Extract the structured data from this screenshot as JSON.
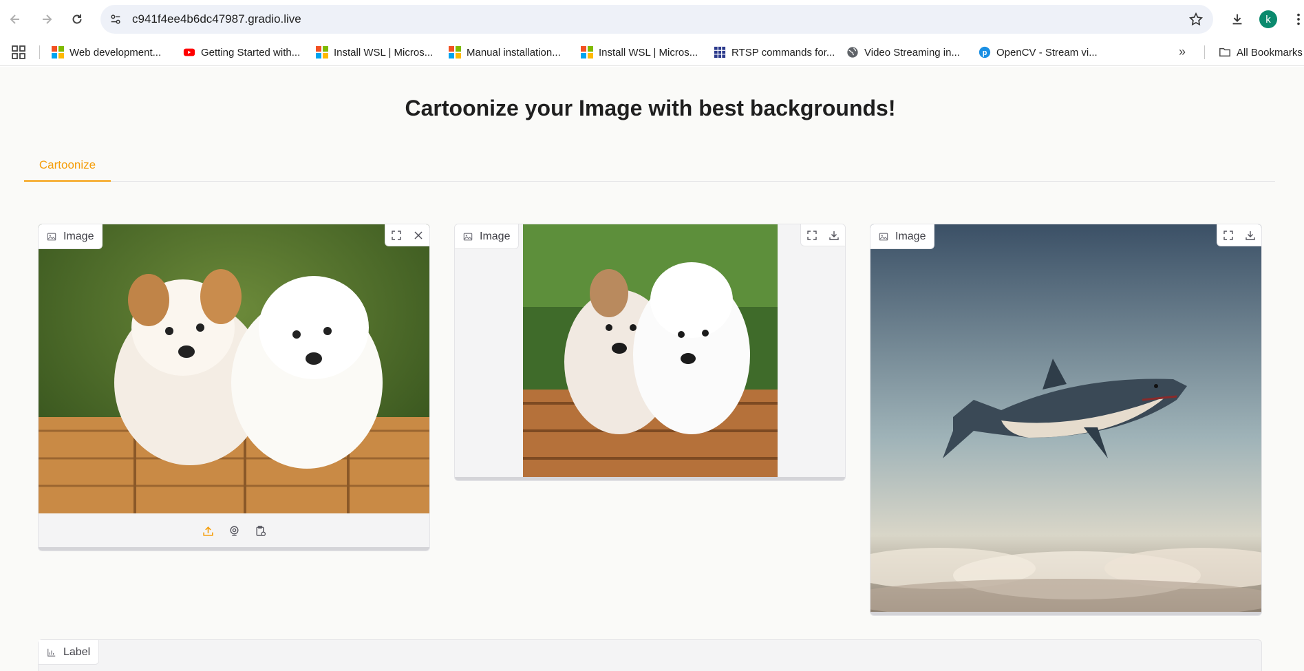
{
  "browser": {
    "url": "c941f4ee4b6dc47987.gradio.live",
    "avatar_letter": "k",
    "bookmarks": [
      {
        "label": "Web development...",
        "icon": "microsoft-icon"
      },
      {
        "label": "Getting Started with...",
        "icon": "youtube-icon"
      },
      {
        "label": "Install WSL | Micros...",
        "icon": "microsoft-icon"
      },
      {
        "label": "Manual installation...",
        "icon": "microsoft-icon"
      },
      {
        "label": "Install WSL | Micros...",
        "icon": "microsoft-icon"
      },
      {
        "label": "RTSP commands for...",
        "icon": "grid-site-icon"
      },
      {
        "label": "Video Streaming in...",
        "icon": "globe-icon"
      },
      {
        "label": "OpenCV - Stream vi...",
        "icon": "p-site-icon"
      }
    ],
    "all_bookmarks_label": "All Bookmarks"
  },
  "app": {
    "title": "Cartoonize your Image with best backgrounds!",
    "tab_label": "Cartoonize",
    "input_image_label": "Image",
    "cartoon_image_label": "Image",
    "background_image_label": "Image",
    "result_label": "Label"
  },
  "colors": {
    "accent": "#f59e0b",
    "page_bg": "#fafaf8",
    "panel_bg": "#f4f4f5",
    "avatar_bg": "#0b8a6e"
  }
}
